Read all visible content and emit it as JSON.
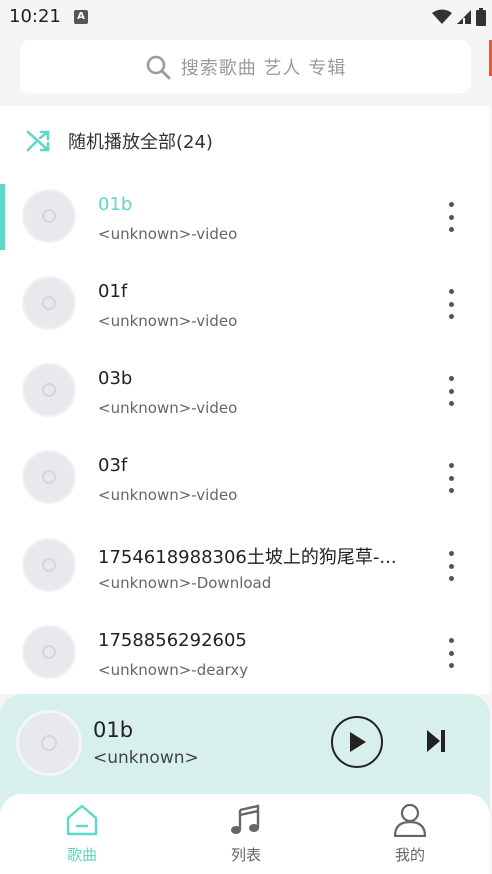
{
  "status_bar": {
    "time": "10:21",
    "notif_letter": "A"
  },
  "search": {
    "placeholder": "搜索歌曲 艺人 专辑"
  },
  "shuffle": {
    "label": "随机播放全部(24)"
  },
  "songs": [
    {
      "title": "01b",
      "subtitle": "<unknown>-video",
      "active": true
    },
    {
      "title": "01f",
      "subtitle": "<unknown>-video"
    },
    {
      "title": "03b",
      "subtitle": "<unknown>-video"
    },
    {
      "title": "03f",
      "subtitle": "<unknown>-video"
    },
    {
      "title": "1754618988306土坡上的狗尾草-...",
      "subtitle": "<unknown>-Download"
    },
    {
      "title": "1758856292605",
      "subtitle": "<unknown>-dearxy"
    }
  ],
  "player": {
    "title": "01b",
    "artist": "<unknown>"
  },
  "nav": {
    "songs": "歌曲",
    "list": "列表",
    "mine": "我的"
  },
  "colors": {
    "accent": "#5fd8c8",
    "player_bg": "#d8f0ec"
  }
}
